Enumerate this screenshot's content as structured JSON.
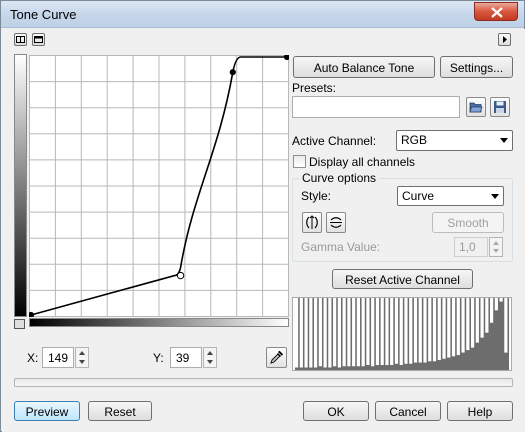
{
  "window": {
    "title": "Tone Curve"
  },
  "toolbar": {
    "left_icon_1": "dock-icon",
    "left_icon_2": "window-icon",
    "right_icon": "arrow-right-icon"
  },
  "curve": {
    "grid_divisions": 10,
    "control_points": [
      {
        "input": 0,
        "output": 0
      },
      {
        "input": 149,
        "output": 39
      },
      {
        "input": 201,
        "output": 240
      },
      {
        "input": 255,
        "output": 255
      }
    ],
    "selected_point_index": 1
  },
  "buttons": {
    "auto_balance": "Auto Balance Tone",
    "settings": "Settings...",
    "smooth": "Smooth",
    "reset_channel": "Reset Active Channel",
    "preview": "Preview",
    "reset": "Reset",
    "ok": "OK",
    "cancel": "Cancel",
    "help": "Help"
  },
  "presets": {
    "label": "Presets:",
    "value": "",
    "open_icon": "folder-open-icon",
    "save_icon": "save-icon"
  },
  "channel": {
    "label": "Active Channel:",
    "value": "RGB"
  },
  "display_all": {
    "label": "Display all channels",
    "checked": false
  },
  "curve_options": {
    "title": "Curve options",
    "style_label": "Style:",
    "style_value": "Curve",
    "gamma_label": "Gamma Value:",
    "gamma_value": "1,0"
  },
  "coords": {
    "x_label": "X:",
    "x_value": "149",
    "y_label": "Y:",
    "y_value": "39",
    "picker_icon": "eyedropper-icon"
  },
  "histogram": [
    2,
    2,
    2,
    2,
    2,
    3,
    2,
    2,
    3,
    2,
    3,
    3,
    3,
    3,
    3,
    4,
    3,
    4,
    4,
    4,
    4,
    5,
    4,
    5,
    5,
    6,
    6,
    6,
    7,
    7,
    8,
    9,
    10,
    11,
    12,
    14,
    16,
    18,
    22,
    26,
    30,
    38,
    48,
    55,
    14
  ]
}
